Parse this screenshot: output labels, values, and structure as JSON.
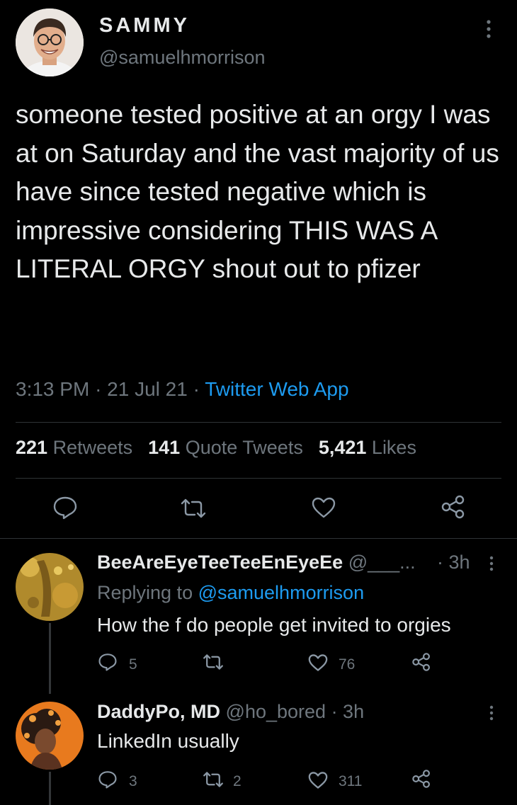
{
  "tweet": {
    "display_name": "SAMMY",
    "handle": "@samuelhmorrison",
    "text": "someone tested positive at an orgy I was at on Saturday and the vast majority of us have since tested negative which is impressive considering THIS WAS A LITERAL ORGY shout out to pfizer",
    "time": "3:13 PM",
    "date": "21 Jul 21",
    "dot": "·",
    "source": "Twitter Web App",
    "stats": {
      "retweets_count": "221",
      "retweets_label": "Retweets",
      "quotes_count": "141",
      "quotes_label": "Quote Tweets",
      "likes_count": "5,421",
      "likes_label": "Likes"
    }
  },
  "icons": {
    "reply": "comment-icon",
    "retweet": "retweet-icon",
    "like": "heart-icon",
    "share": "share-icon",
    "more": "more-vertical-icon"
  },
  "replies": [
    {
      "name": "BeeAreEyeTeeTeeEnEyeEe",
      "handle": "@___...",
      "time": "· 3h",
      "replying_prefix": "Replying to",
      "replying_to": "@samuelhmorrison",
      "text": "How the f do people get invited to orgies",
      "reply_count": "5",
      "retweet_count": "",
      "like_count": "76"
    },
    {
      "name": "DaddyPo, MD",
      "handle": "@ho_bored",
      "time": "· 3h",
      "text": "LinkedIn usually",
      "reply_count": "3",
      "retweet_count": "2",
      "like_count": "311"
    }
  ],
  "colors": {
    "background": "#000000",
    "link": "#1d9bf0",
    "muted": "#6e767d",
    "text": "#e7e9ea"
  }
}
